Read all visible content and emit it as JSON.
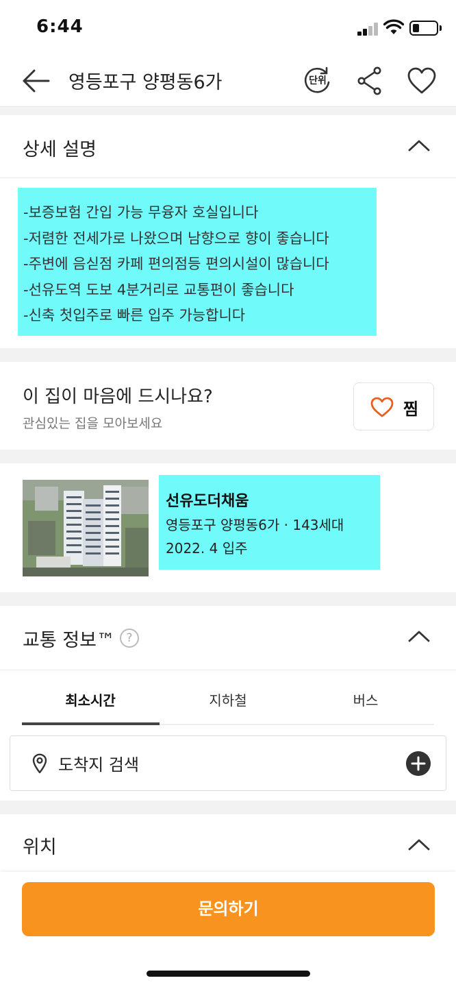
{
  "status_bar": {
    "time": "6:44",
    "battery_level": 0.3
  },
  "header": {
    "title": "영등포구 양평동6가",
    "unit_label": "단위"
  },
  "description": {
    "title": "상세 설명",
    "lines": [
      "-보증보험 간입 가능 무융자 호실입니다",
      "-저렴한 전세가로 나왔으며 남향으로 향이 좋습니다",
      "-주변에 음싣점 카페 편의점등 편의시설이 많습니다",
      "-선유도역 도보 4분거리로 교통편이 좋습니다",
      "-신축 첫입주로 빠른 입주 가능합니다"
    ]
  },
  "like_card": {
    "title": "이 집이 마음에 드시나요?",
    "subtitle": "관심있는 집을 모아보세요",
    "button_label": "찜"
  },
  "complex": {
    "name": "선유도더채움",
    "address_line": "영등포구 양평동6가 · 143세대",
    "move_in": "2022. 4 입주"
  },
  "transport": {
    "title": "교통 정보™",
    "help": "?",
    "tabs": [
      {
        "label": "최소시간"
      },
      {
        "label": "지하철"
      },
      {
        "label": "버스"
      }
    ],
    "active_tab": "최소시간",
    "destination_placeholder": "도착지 검색"
  },
  "location": {
    "title": "위치"
  },
  "footer": {
    "inquiry_label": "문의하기"
  },
  "colors": {
    "accent": "#f7931e",
    "highlight": "#70fafa",
    "heart_orange": "#e8601c"
  }
}
